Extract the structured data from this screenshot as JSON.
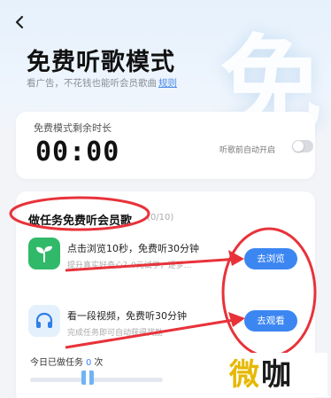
{
  "header": {
    "back_icon": "chevron-left-icon",
    "background_glyph": "免",
    "title": "免费听歌模式",
    "subtitle": "看广告，不花钱也能听会员歌曲",
    "rules_link": "规则"
  },
  "timer": {
    "label": "免费模式剩余时长",
    "value": "00:00",
    "auto_label": "听歌前自动开启",
    "auto_on": false
  },
  "tasks": {
    "title": "做任务免费听会员歌",
    "count": "(0/10)",
    "items": [
      {
        "icon": "sprout-icon",
        "title": "点击浏览10秒，免费听30分钟",
        "desc": "提升真实好奇心？0元试学，逐梦...",
        "button": "去浏览"
      },
      {
        "icon": "headphones-icon",
        "title": "看一段视频，免费听30分钟",
        "desc": "完成任务即可自动获得奖励",
        "button": "去观看"
      }
    ]
  },
  "progress": {
    "label_prefix": "今日已做任务",
    "done": "0",
    "label_suffix": "次"
  },
  "watermark": {
    "text_a": "微",
    "text_b": "咖"
  },
  "colors": {
    "accent": "#3c86f2",
    "annotation": "#e8323a",
    "task_green": "#31b96a"
  }
}
